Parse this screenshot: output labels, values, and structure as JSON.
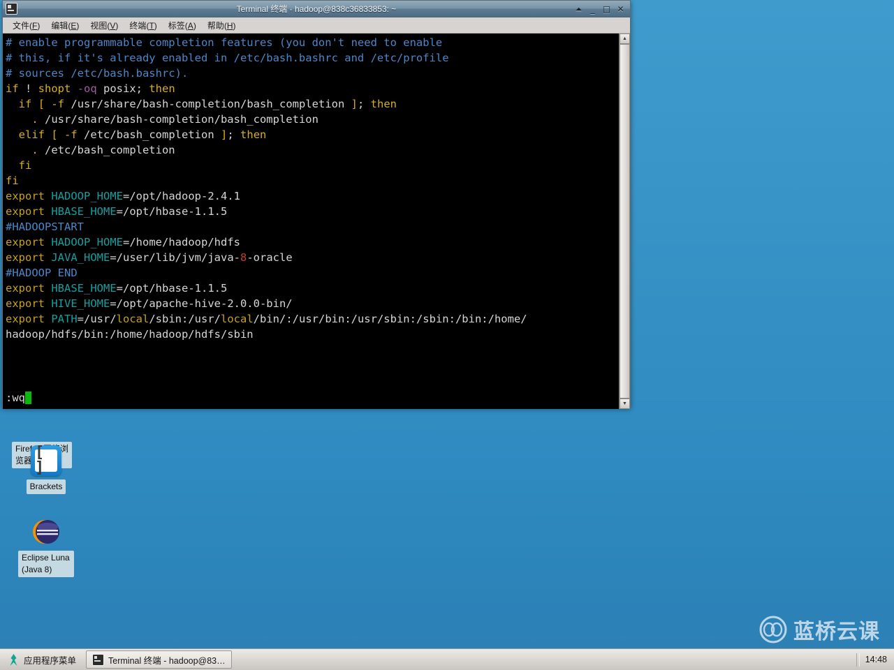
{
  "window": {
    "title": "Terminal 终端 - hadoop@838c36833853: ~",
    "icon": "terminal-icon",
    "buttons": {
      "shade": "⏶",
      "minimize": "_",
      "maximize": "□",
      "close": "✕"
    },
    "menus": [
      {
        "label": "文件",
        "mnemonic": "F"
      },
      {
        "label": "编辑",
        "mnemonic": "E"
      },
      {
        "label": "视图",
        "mnemonic": "V"
      },
      {
        "label": "终端",
        "mnemonic": "T"
      },
      {
        "label": "标签",
        "mnemonic": "A"
      },
      {
        "label": "帮助",
        "mnemonic": "H"
      }
    ],
    "scrollbar": {
      "up_arrow": "▲",
      "down_arrow": "▼"
    }
  },
  "terminal": {
    "lines": [
      [
        {
          "t": "# enable programmable completion features (you don't need to enable",
          "c": "c-comment"
        }
      ],
      [
        {
          "t": "# this, if it's already enabled in /etc/bash.bashrc and /etc/profile",
          "c": "c-comment"
        }
      ],
      [
        {
          "t": "# sources /etc/bash.bashrc).",
          "c": "c-comment"
        }
      ],
      [
        {
          "t": "if",
          "c": "c-kw"
        },
        {
          "t": " ! ",
          "c": "c-plain"
        },
        {
          "t": "shopt",
          "c": "c-kw"
        },
        {
          "t": " ",
          "c": "c-plain"
        },
        {
          "t": "-oq",
          "c": "c-opt"
        },
        {
          "t": " posix; ",
          "c": "c-plain"
        },
        {
          "t": "then",
          "c": "c-kw"
        }
      ],
      [
        {
          "t": "  ",
          "c": "c-plain"
        },
        {
          "t": "if",
          "c": "c-kw"
        },
        {
          "t": " ",
          "c": "c-plain"
        },
        {
          "t": "[",
          "c": "c-kw"
        },
        {
          "t": " ",
          "c": "c-plain"
        },
        {
          "t": "-f",
          "c": "c-kw"
        },
        {
          "t": " /usr/share/bash-completion/bash_completion ",
          "c": "c-plain"
        },
        {
          "t": "]",
          "c": "c-kw"
        },
        {
          "t": "; ",
          "c": "c-plain"
        },
        {
          "t": "then",
          "c": "c-kw"
        }
      ],
      [
        {
          "t": "    ",
          "c": "c-plain"
        },
        {
          "t": ".",
          "c": "c-kw"
        },
        {
          "t": " /usr/share/bash-completion/bash_completion",
          "c": "c-plain"
        }
      ],
      [
        {
          "t": "  ",
          "c": "c-plain"
        },
        {
          "t": "elif",
          "c": "c-kw"
        },
        {
          "t": " ",
          "c": "c-plain"
        },
        {
          "t": "[",
          "c": "c-kw"
        },
        {
          "t": " ",
          "c": "c-plain"
        },
        {
          "t": "-f",
          "c": "c-kw"
        },
        {
          "t": " /etc/bash_completion ",
          "c": "c-plain"
        },
        {
          "t": "]",
          "c": "c-kw"
        },
        {
          "t": "; ",
          "c": "c-plain"
        },
        {
          "t": "then",
          "c": "c-kw"
        }
      ],
      [
        {
          "t": "    ",
          "c": "c-plain"
        },
        {
          "t": ".",
          "c": "c-kw"
        },
        {
          "t": " /etc/bash_completion",
          "c": "c-plain"
        }
      ],
      [
        {
          "t": "  ",
          "c": "c-plain"
        },
        {
          "t": "fi",
          "c": "c-kw"
        }
      ],
      [
        {
          "t": "fi",
          "c": "c-kw"
        }
      ],
      [
        {
          "t": "export",
          "c": "c-key"
        },
        {
          "t": " ",
          "c": "c-plain"
        },
        {
          "t": "HADOOP_HOME",
          "c": "c-var"
        },
        {
          "t": "=/opt/hadoop-2.4.1",
          "c": "c-plain"
        }
      ],
      [
        {
          "t": "export",
          "c": "c-key"
        },
        {
          "t": " ",
          "c": "c-plain"
        },
        {
          "t": "HBASE_HOME",
          "c": "c-var"
        },
        {
          "t": "=/opt/hbase-1.1.5",
          "c": "c-plain"
        }
      ],
      [
        {
          "t": "#HADOOPSTART",
          "c": "c-comment"
        }
      ],
      [
        {
          "t": "export",
          "c": "c-key"
        },
        {
          "t": " ",
          "c": "c-plain"
        },
        {
          "t": "HADOOP_HOME",
          "c": "c-var"
        },
        {
          "t": "=/home/hadoop/hdfs",
          "c": "c-plain"
        }
      ],
      [
        {
          "t": "export",
          "c": "c-key"
        },
        {
          "t": " ",
          "c": "c-plain"
        },
        {
          "t": "JAVA_HOME",
          "c": "c-var"
        },
        {
          "t": "=/user/lib/jvm/java-",
          "c": "c-plain"
        },
        {
          "t": "8",
          "c": "c-num"
        },
        {
          "t": "-oracle",
          "c": "c-plain"
        }
      ],
      [
        {
          "t": "#HADOOP END",
          "c": "c-comment"
        }
      ],
      [
        {
          "t": "export",
          "c": "c-key"
        },
        {
          "t": " ",
          "c": "c-plain"
        },
        {
          "t": "HBASE_HOME",
          "c": "c-var"
        },
        {
          "t": "=/opt/hbase-1.1.5",
          "c": "c-plain"
        }
      ],
      [
        {
          "t": "export",
          "c": "c-key"
        },
        {
          "t": " ",
          "c": "c-plain"
        },
        {
          "t": "HIVE_HOME",
          "c": "c-var"
        },
        {
          "t": "=/opt/apache-hive-2.0.0-bin/",
          "c": "c-plain"
        }
      ],
      [
        {
          "t": "export",
          "c": "c-key"
        },
        {
          "t": " ",
          "c": "c-plain"
        },
        {
          "t": "PATH",
          "c": "c-var"
        },
        {
          "t": "=/usr/",
          "c": "c-plain"
        },
        {
          "t": "local",
          "c": "c-yellow"
        },
        {
          "t": "/sbin:/usr/",
          "c": "c-plain"
        },
        {
          "t": "local",
          "c": "c-yellow"
        },
        {
          "t": "/bin/:/usr/bin:/usr/sbin:/sbin:/bin:/home/",
          "c": "c-plain"
        }
      ],
      [
        {
          "t": "hadoop/hdfs/bin:/home/hadoop/hdfs/sbin",
          "c": "c-plain"
        }
      ]
    ],
    "command_line": ":wq",
    "cursor": "block-cursor"
  },
  "desktop": {
    "icons": [
      {
        "name": "firefox",
        "label": "Firefox 网络浏览器",
        "icon": "firefox-icon"
      },
      {
        "name": "brackets",
        "label": "Brackets",
        "icon": "brackets-icon",
        "glyph": "[ ]"
      },
      {
        "name": "eclipse",
        "label": "Eclipse Luna (Java 8)",
        "icon": "eclipse-icon"
      }
    ]
  },
  "taskbar": {
    "app_menu_label": "应用程序菜单",
    "app_menu_icon": "xfce-mouse-icon",
    "windows": [
      {
        "label": "Terminal 终端 - hadoop@83…",
        "icon": "terminal-icon"
      }
    ],
    "clock": "14:48"
  },
  "watermark": {
    "text": "蓝桥云课",
    "icon": "lanqiao-logo-icon"
  },
  "colors": {
    "desktop_top": "#3f9bcc",
    "desktop_bottom": "#2b7fb4",
    "terminal_bg": "#000000",
    "cursor_green": "#0bb80b",
    "titlebar": "#5d7b91"
  }
}
